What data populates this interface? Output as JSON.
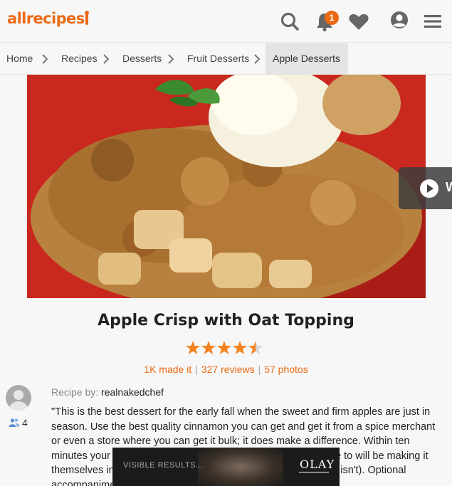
{
  "header": {
    "logo": "allrecipes",
    "notification_count": "1",
    "icons": [
      "search-icon",
      "bell-icon",
      "heart-icon",
      "user-icon",
      "menu-icon"
    ]
  },
  "breadcrumb": [
    "Home",
    "Recipes",
    "Desserts",
    "Fruit Desserts",
    "Apple Desserts"
  ],
  "video": {
    "label": "W"
  },
  "recipe": {
    "title": "Apple Crisp with Oat Topping",
    "rating": 4.5,
    "made_it": "1K made it",
    "reviews": "327 reviews",
    "photos": "57 photos",
    "recipe_by_label": "Recipe by:",
    "author": "realnakedchef",
    "followers": "4",
    "description": "\"This is the best dessert for the early fall when the sweet and firm apples are just in season. Use the best quality cinnamon you can get and get it from a spice merchant or even a store where you can get it bulk; it does make a difference. Within ten minutes your whole house and neighbors you loaned the recipe to will be making it themselves in and wonder aloud if there is any left (Note: there isn't). Optional accompaniments..."
  },
  "ad": {
    "text": "VISIBLE RESULTS...",
    "brand": "OLAY"
  },
  "colors": {
    "accent": "#ec6a15",
    "plate_red": "#c8281e",
    "star": "#f58220"
  }
}
